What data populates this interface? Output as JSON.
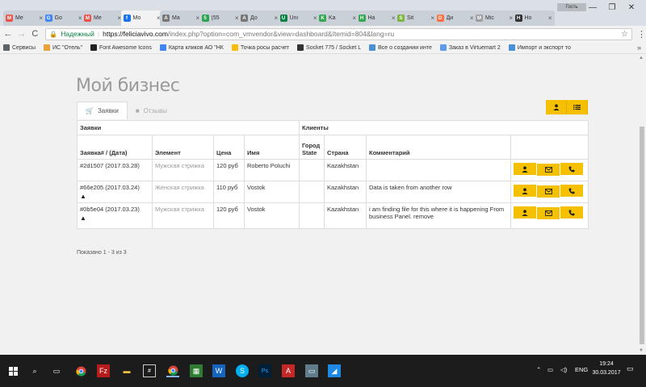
{
  "browser": {
    "tabs": [
      {
        "label": "Me",
        "color": "#e8534a",
        "glyph": "M"
      },
      {
        "label": "Go",
        "color": "#4285f4",
        "glyph": "G"
      },
      {
        "label": "Me",
        "color": "#e8534a",
        "glyph": "M"
      },
      {
        "label": "Mo",
        "color": "#1a73e8",
        "glyph": "f",
        "active": true
      },
      {
        "label": "Ma",
        "color": "#777777",
        "glyph": "A"
      },
      {
        "label": "(55",
        "color": "#2da44e",
        "glyph": "5"
      },
      {
        "label": "До",
        "color": "#777777",
        "glyph": "A"
      },
      {
        "label": "Uni",
        "color": "#0b8043",
        "glyph": "U"
      },
      {
        "label": "Ka",
        "color": "#34a853",
        "glyph": "K"
      },
      {
        "label": "Ha",
        "color": "#34a853",
        "glyph": "H"
      },
      {
        "label": "Sit",
        "color": "#7cb342",
        "glyph": "S"
      },
      {
        "label": "Ди",
        "color": "#ff7043",
        "glyph": "D"
      },
      {
        "label": "Mic",
        "color": "#9e9e9e",
        "glyph": "M"
      },
      {
        "label": "Ho",
        "color": "#333333",
        "glyph": "H"
      }
    ],
    "profile_label": "Гость",
    "window_controls": {
      "minimize": "—",
      "restore": "❐",
      "close": "✕"
    },
    "nav": {
      "back": "←",
      "forward": "→",
      "reload": "C"
    },
    "address": {
      "security_label": "Надежный",
      "url_host": "https://feliciavivo.com",
      "url_path": "/index.php?option=com_vmvendor&view=dashboard&Itemid=804&lang=ru"
    },
    "bookmarks": [
      {
        "label": "Сервисы",
        "color": "#5f6368"
      },
      {
        "label": "ИС \"Отель\"",
        "color": "#e8a33d"
      },
      {
        "label": "Font Awesome Icons",
        "color": "#222222"
      },
      {
        "label": "Карта кликов АО \"НК",
        "color": "#4285f4"
      },
      {
        "label": "Точка росы расчет",
        "color": "#fbbc05"
      },
      {
        "label": "Socket 775 / Socket L",
        "color": "#333333"
      },
      {
        "label": "Все о создании инте",
        "color": "#4a90d9"
      },
      {
        "label": "Заказ в Virtuemart 2",
        "color": "#5d9cec"
      },
      {
        "label": "Импорт и экспорт то",
        "color": "#4a90d9"
      }
    ],
    "bookmarks_more": "»"
  },
  "page": {
    "title": "Мой бизнес",
    "tabs": [
      {
        "label": "Заявки",
        "icon": "cart-icon",
        "active": true
      },
      {
        "label": "Отзывы",
        "icon": "comment-icon",
        "active": false
      }
    ],
    "table": {
      "group_headers": {
        "orders": "Заявки",
        "clients": "Клиенты"
      },
      "columns": {
        "order": "Заявка# / (Дата)",
        "element": "Элемент",
        "price": "Цена",
        "name": "Имя",
        "city": "Город State",
        "country": "Страна",
        "comment": "Комментарий"
      },
      "rows": [
        {
          "order": "#2d1507 (2017.03.28)",
          "element": "Мужская стрижка",
          "price": "120 руб",
          "name": "Roberto Poluchi",
          "city": "",
          "country": "Kazakhstan",
          "comment": "",
          "warning": false
        },
        {
          "order": "#66e205 (2017.03.24)",
          "element": "Женская стрижка",
          "price": "110 руб",
          "name": "Vostok",
          "city": "",
          "country": "Kazakhstan",
          "comment": "Data is taken from another row",
          "warning": true
        },
        {
          "order": "#0b5e04 (2017.03.23)",
          "element": "Мужская стрижка",
          "price": "120 руб",
          "name": "Vostok",
          "city": "",
          "country": "Kazakhstan",
          "comment": "i am finding file for this where it is happening From business Panel. remove",
          "warning": true
        }
      ]
    },
    "showing": "Показано 1 - 3 из 3",
    "accent_color": "#f5c000"
  },
  "taskbar": {
    "language": "ENG",
    "time": "19:24",
    "date": "30.03.2017"
  }
}
